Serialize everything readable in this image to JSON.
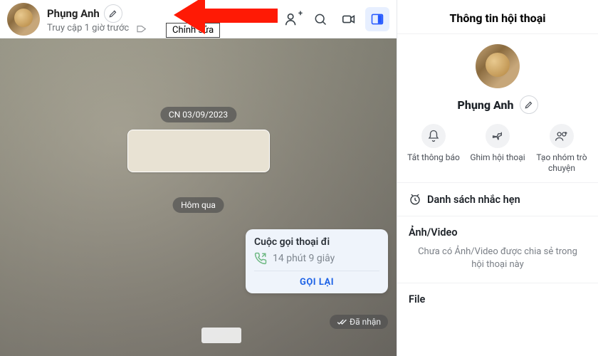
{
  "header": {
    "name": "Phụng Anh",
    "last_seen": "Truy cập 1 giờ trước",
    "edit_tooltip": "Chỉnh sửa"
  },
  "chat": {
    "date1": "CN 03/09/2023",
    "date2": "Hôm qua",
    "call": {
      "title": "Cuộc gọi thoại đi",
      "duration": "14 phút 9 giây",
      "callback": "GỌI LẠI"
    },
    "receipt": "Đã nhận"
  },
  "side": {
    "title": "Thông tin hội thoại",
    "name": "Phụng Anh",
    "actions": {
      "mute": "Tắt thông báo",
      "pin": "Ghim hội thoại",
      "group": "Tạo nhóm trò chuyện"
    },
    "reminders": "Danh sách nhắc hẹn",
    "media_h": "Ảnh/Video",
    "media_empty": "Chưa có Ảnh/Video được chia sẻ trong hội thoại này",
    "file_h": "File"
  }
}
